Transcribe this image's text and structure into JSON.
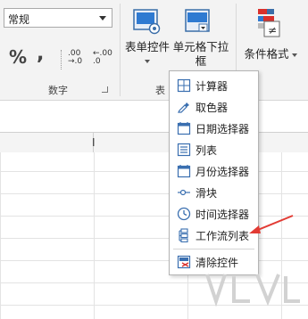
{
  "ribbon": {
    "number_format": {
      "value": "常规"
    },
    "number_group": {
      "percent": "%",
      "comma": ",",
      "increase_decimal": {
        "top": ".00",
        "bottom": "→.0"
      },
      "decrease_decimal": {
        "top": "←.00",
        "bottom": ".0"
      },
      "label": "数字"
    },
    "form_controls": {
      "label": "表单控件",
      "group_label_partial": "表"
    },
    "cell_dropdown": {
      "label_line1": "单元格下拉",
      "label_line2": "框"
    },
    "conditional_format": {
      "label": "条件格式"
    },
    "colors": {
      "accent_blue": "#1f6fbf",
      "icon_red": "#d9302c"
    }
  },
  "sheet": {
    "column_marker": "I"
  },
  "menu": {
    "items": [
      {
        "label": "计算器",
        "icon": "calculator-icon"
      },
      {
        "label": "取色器",
        "icon": "color-picker-icon"
      },
      {
        "label": "日期选择器",
        "icon": "calendar-icon"
      },
      {
        "label": "列表",
        "icon": "list-icon"
      },
      {
        "label": "月份选择器",
        "icon": "month-calendar-icon"
      },
      {
        "label": "滑块",
        "icon": "slider-icon"
      },
      {
        "label": "时间选择器",
        "icon": "clock-icon"
      },
      {
        "label": "工作流列表",
        "icon": "workflow-icon"
      },
      {
        "label": "清除控件",
        "icon": "clear-control-icon"
      }
    ]
  },
  "annotation": {
    "arrow_color": "#e23b34"
  }
}
